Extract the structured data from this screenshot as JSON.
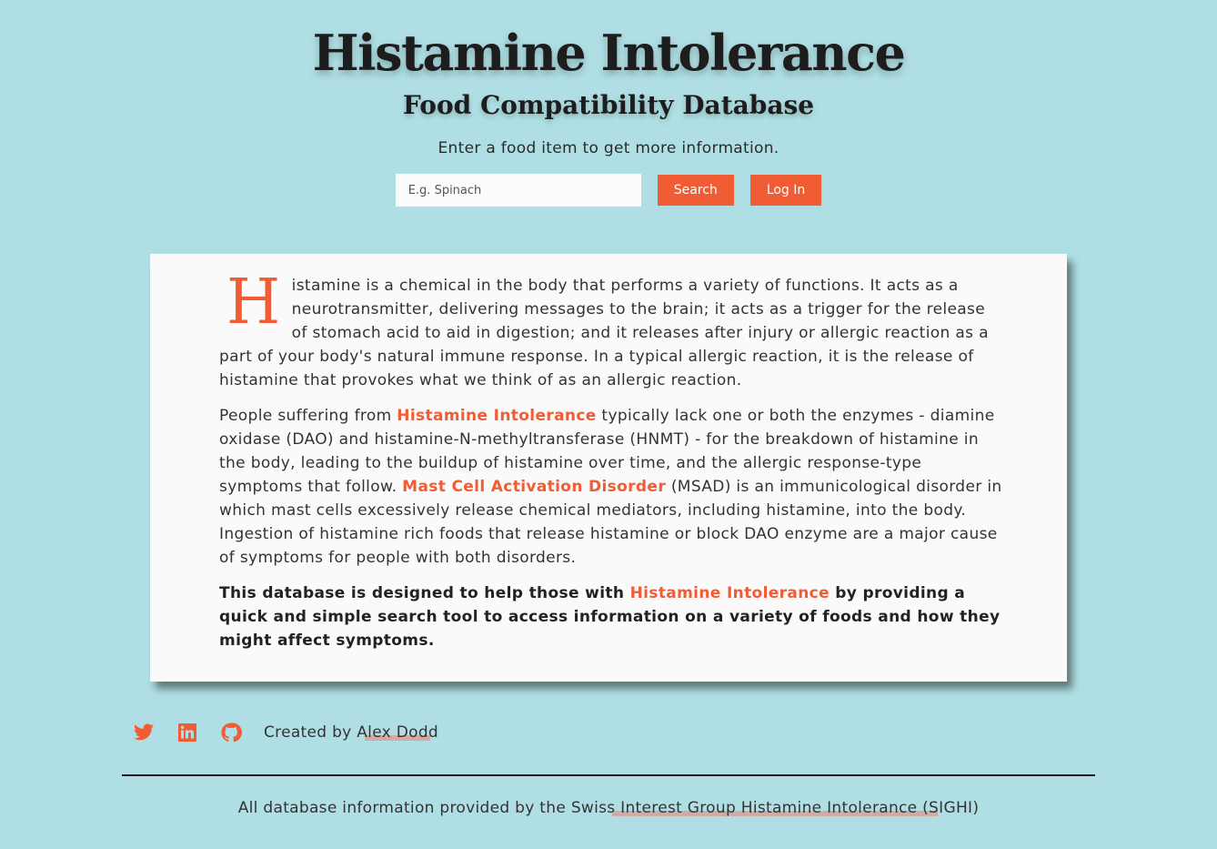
{
  "header": {
    "title": "Histamine Intolerance",
    "subtitle": "Food Compatibility Database",
    "prompt": "Enter a food item to get more information."
  },
  "search": {
    "placeholder": "E.g. Spinach",
    "value": "",
    "search_label": "Search",
    "login_label": "Log In"
  },
  "intro": {
    "drop_cap": "H",
    "p1_rest": "istamine is a chemical in the body that performs a variety of functions. It acts as a neurotransmitter, delivering messages to the brain; it acts as a trigger for the release of stomach acid to aid in digestion; and it releases after injury or allergic reaction as a part of your body's natural immune response. In a typical allergic reaction, it is the release of histamine that provokes what we think of as an allergic reaction.",
    "p2_a": "People suffering from ",
    "p2_link1": "Histamine Intolerance",
    "p2_b": " typically lack one or both the enzymes - diamine oxidase (DAO) and histamine-N-methyltransferase (HNMT) - for the breakdown of histamine in the body, leading to the buildup of histamine over time, and the allergic response-type symptoms that follow. ",
    "p2_link2": "Mast Cell Activation Disorder",
    "p2_c": " (MSAD) is an immunicological disorder in which mast cells excessively release chemical mediators, including histamine, into the body. Ingestion of histamine rich foods that release histamine or block DAO enzyme are a major cause of symptoms for people with both disorders.",
    "p3_a": "This database is designed to help those with ",
    "p3_link": "Histamine Intolerance",
    "p3_b": " by providing a quick and simple search tool to access information on a variety of foods and how they might affect symptoms."
  },
  "social": {
    "icons": [
      "twitter-icon",
      "linkedin-icon",
      "github-icon"
    ],
    "credit_prefix": "Created by ",
    "author": "Alex Dodd"
  },
  "footer": {
    "prefix": "All database information provided by the ",
    "source": "Swiss Interest Group Histamine Intolerance (SIGHI)"
  },
  "colors": {
    "background": "#afdfe4",
    "accent": "#f05d35",
    "card": "#fafafa"
  }
}
